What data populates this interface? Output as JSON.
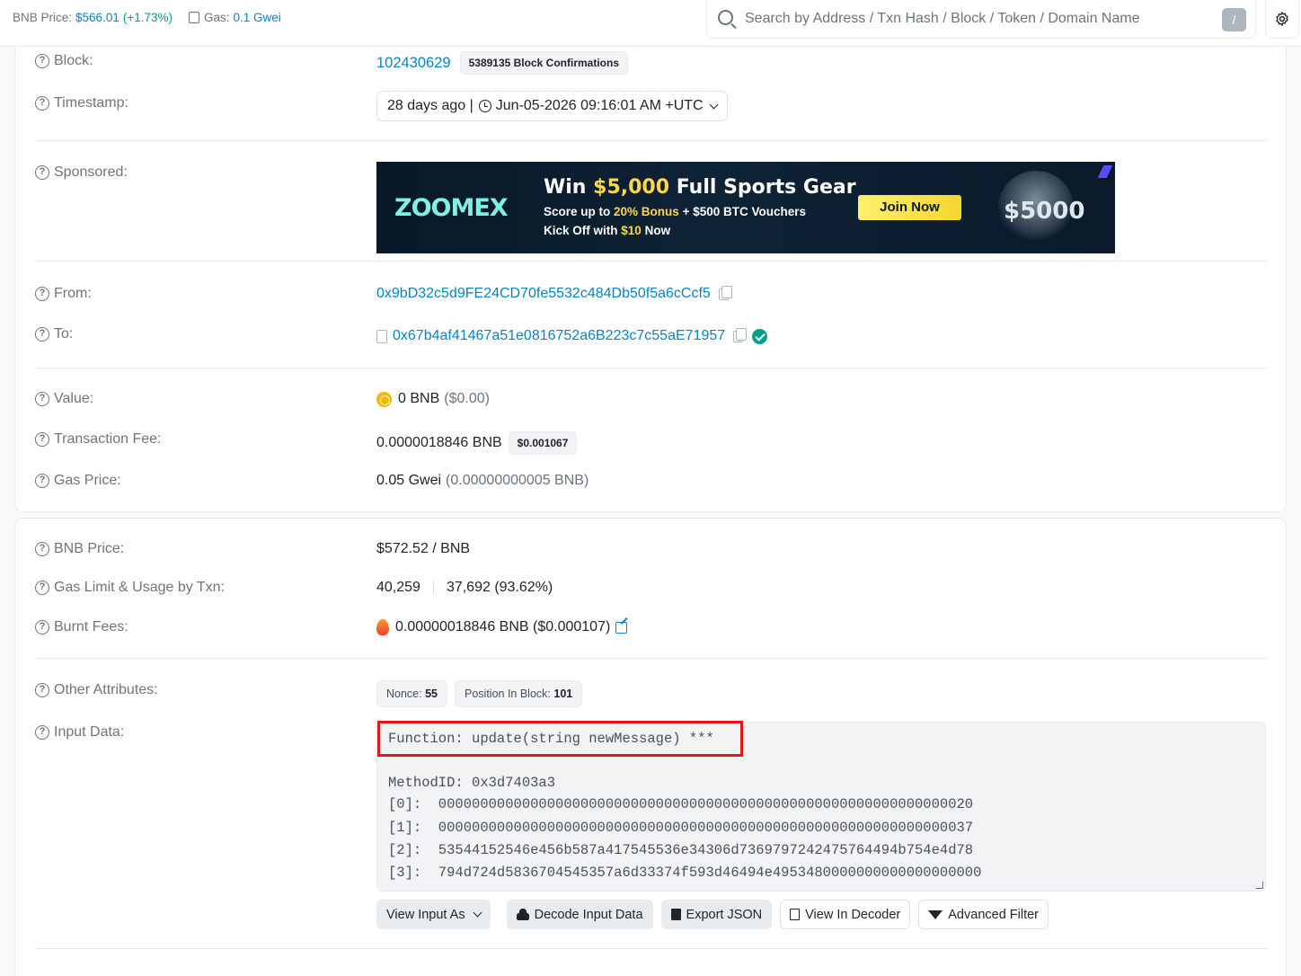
{
  "header": {
    "bnb_price_label": "BNB Price:",
    "bnb_price_value": "$566.01",
    "bnb_price_change": "(+1.73%)",
    "gas_label": "Gas:",
    "gas_value": "0.1 Gwei",
    "search_placeholder": "Search by Address / Txn Hash / Block / Token / Domain Name",
    "search_shortcut": "/"
  },
  "overview": {
    "block_label": "Block:",
    "block_value": "102430629",
    "block_confirmations": "5389135 Block Confirmations",
    "timestamp_label": "Timestamp:",
    "timestamp_relative": "28 days ago |",
    "timestamp_value": "Jun-05-2026 09:16:01 AM +UTC",
    "sponsored_label": "Sponsored:",
    "from_label": "From:",
    "from_value": "0x9bD32c5d9FE24CD70fe5532c484Db50f5a6cCcf5",
    "to_label": "To:",
    "to_value": "0x67b4af41467a51e0816752a6B223c7c55aE71957",
    "value_label": "Value:",
    "value_amount": "0 BNB",
    "value_usd": "($0.00)",
    "fee_label": "Transaction Fee:",
    "fee_value": "0.0000018846 BNB",
    "fee_usd": "$0.001067",
    "gas_price_label": "Gas Price:",
    "gas_price_value": "0.05 Gwei",
    "gas_price_bnb": "(0.00000000005 BNB)"
  },
  "ad": {
    "logo": "ZOOMEX",
    "headline_pre": "Win",
    "headline_amount": "$5,000",
    "headline_post": "Full Sports Gear",
    "line1_pre": "Score up to",
    "line1_bonus": "20% Bonus",
    "line1_mid": "+",
    "line1_voucher": "$500 BTC Vouchers",
    "line2_pre": "Kick Off with",
    "line2_amount": "$10",
    "line2_post": "Now",
    "cta": "Join Now",
    "trophy_text": "$5000"
  },
  "more": {
    "bnb_price_label": "BNB Price:",
    "bnb_price_value": "$572.52 / BNB",
    "gas_limit_label": "Gas Limit & Usage by Txn:",
    "gas_limit_value": "40,259",
    "gas_usage_value": "37,692 (93.62%)",
    "burnt_label": "Burnt Fees:",
    "burnt_value": "0.00000018846 BNB ($0.000107)",
    "other_label": "Other Attributes:",
    "nonce_label": "Nonce:",
    "nonce_value": "55",
    "position_label": "Position In Block:",
    "position_value": "101",
    "input_label": "Input Data:"
  },
  "input_data": {
    "function_line": "Function: update(string newMessage) ***",
    "method_line": "MethodID: 0x3d7403a3",
    "params": [
      "[0]:  0000000000000000000000000000000000000000000000000000000000000020",
      "[1]:  0000000000000000000000000000000000000000000000000000000000000037",
      "[2]:  53544152546e456b587a417545536e34306d7369797242475764494b754e4d78",
      "[3]:  794d724d5836704545357a6d33374f593d46494e4953480000000000000000000"
    ]
  },
  "buttons": {
    "view_input_as": "View Input As",
    "decode_input": "Decode Input Data",
    "export_json": "Export JSON",
    "view_in_decoder": "View In Decoder",
    "advanced_filter": "Advanced Filter"
  }
}
